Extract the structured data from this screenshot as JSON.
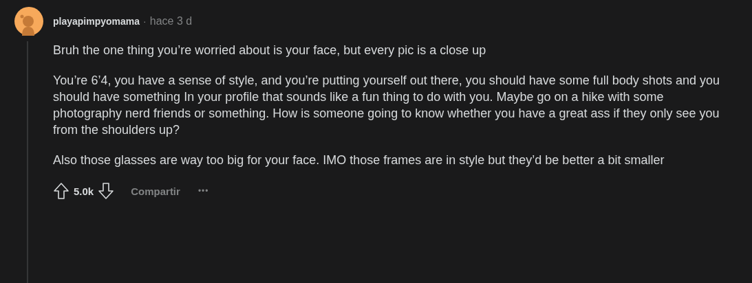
{
  "comment": {
    "author": "playapimpyomama",
    "separator": "·",
    "time": "hace 3 d",
    "paragraphs": [
      "Bruh the one thing you’re worried about is your face, but every pic is a close up",
      "You’re 6’4, you have a sense of style, and you’re putting yourself out there, you should have some full body shots and you should have something In your profile that sounds like a fun thing to do with you. Maybe go on a hike with some photography nerd friends or something. How is someone going to know whether you have a great ass if they only see you from the shoulders up?",
      "Also those glasses are way too big for your face. IMO those frames are in style but they’d be better a bit smaller"
    ],
    "score": "5.0k",
    "share": "Compartir",
    "more": "•••"
  }
}
